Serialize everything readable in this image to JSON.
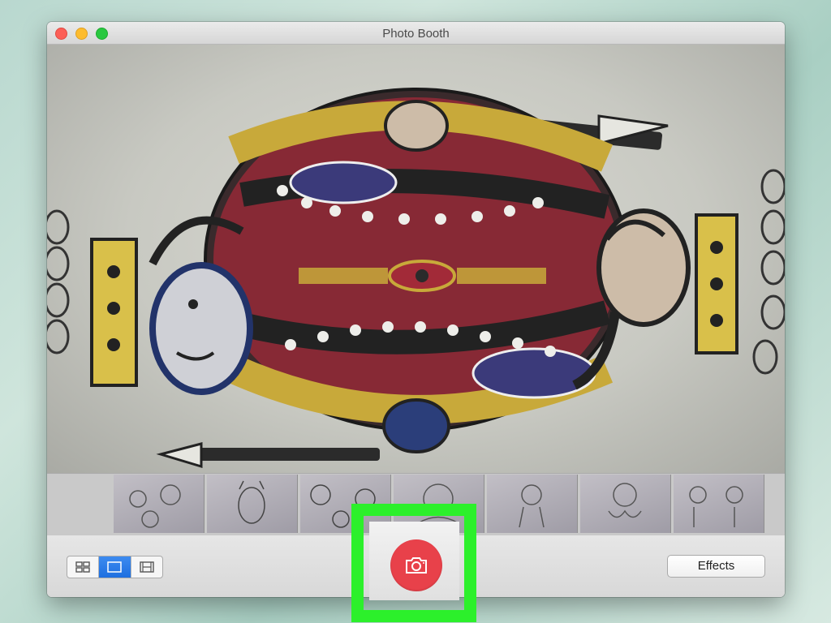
{
  "window": {
    "title": "Photo Booth"
  },
  "toolbar": {
    "view_modes": [
      {
        "name": "grid-view",
        "icon": "four-up-grid-icon",
        "active": false
      },
      {
        "name": "single-view",
        "icon": "single-frame-icon",
        "active": true
      },
      {
        "name": "strip-view",
        "icon": "film-strip-icon",
        "active": false
      }
    ],
    "shutter_icon": "camera-icon",
    "effects_label": "Effects"
  },
  "thumbnails": [
    {
      "subject": "faces-doodles"
    },
    {
      "subject": "devil-face"
    },
    {
      "subject": "goblin-faces"
    },
    {
      "subject": "creature-sketch"
    },
    {
      "subject": "figure-sketch"
    },
    {
      "subject": "octopus-sketch"
    },
    {
      "subject": "characters-sketch"
    }
  ],
  "colors": {
    "accent_blue": "#1e6fe0",
    "shutter_red": "#e8414a",
    "highlight_green": "#2cf02b"
  }
}
